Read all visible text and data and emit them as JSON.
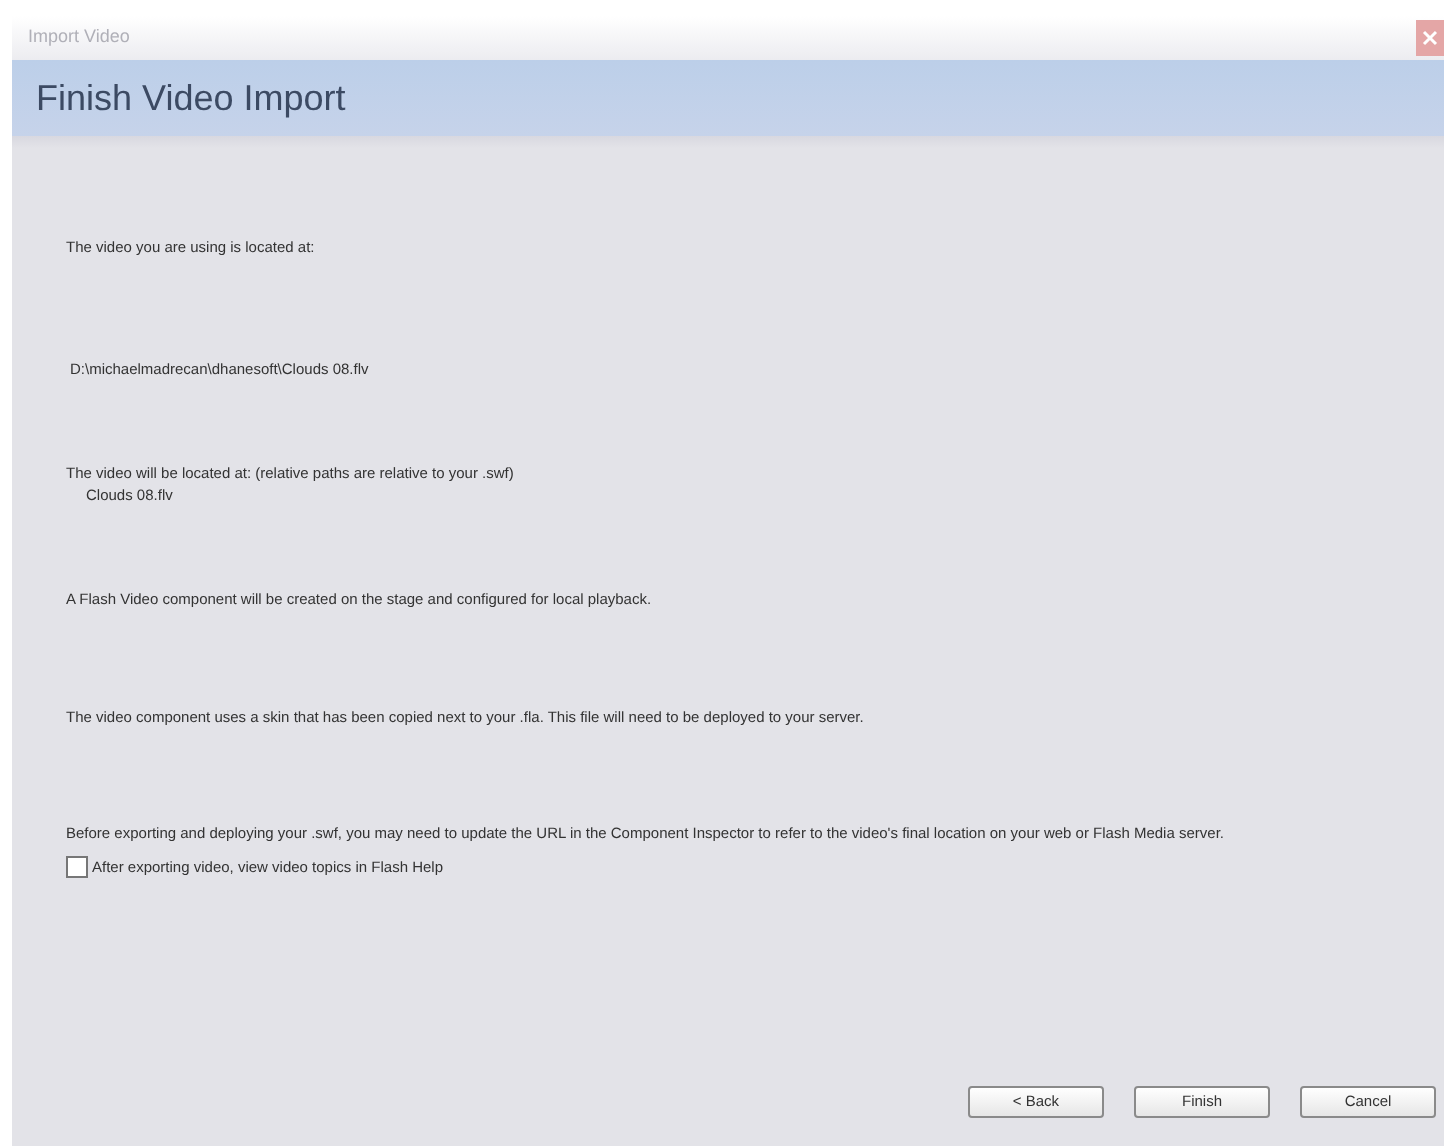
{
  "window": {
    "title": "Import Video"
  },
  "header": {
    "title": "Finish Video Import"
  },
  "paragraphs": [
    {
      "kind": "text",
      "text": "The video you are using is located at:"
    },
    {
      "kind": "path",
      "text": "D:\\michaelmadrecan\\dhanesoft\\Clouds 08.flv"
    },
    {
      "kind": "text",
      "text": "The video will be located at: (relative paths are relative to your .swf)",
      "sub": "Clouds 08.flv"
    },
    {
      "kind": "text",
      "text": "A Flash Video component will be created on the stage and configured for local playback."
    },
    {
      "kind": "text",
      "text": "The video component uses a skin that has been copied next to your .fla. This file will need to be deployed to your server."
    },
    {
      "kind": "text",
      "text": "Before exporting and deploying your .swf, you may need to update the URL in the Component Inspector to refer to the video's final location on your web or Flash Media server."
    }
  ],
  "checkbox": {
    "label": "After exporting video, view video topics in Flash Help",
    "checked": false
  },
  "buttons": [
    "< Back",
    "Finish",
    "Cancel"
  ]
}
